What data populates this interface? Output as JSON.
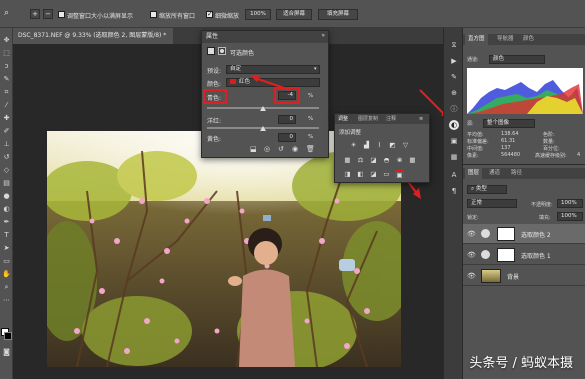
{
  "options_bar": {
    "resize_windows_label": "调整窗口大小以满屏显示",
    "zoom_all_label": "缩放所有窗口",
    "scrubby_zoom_label": "细微缩放",
    "zoom_100": "100%",
    "fit_screen": "适合屏幕",
    "fill_screen": "填充屏幕"
  },
  "document": {
    "tab_title": "DSC_8371.NEF @ 9.33% (选取颜色 2, 图层蒙版/8) *"
  },
  "properties": {
    "panel_title": "属性",
    "adjustment_name": "可选颜色",
    "preset_label": "预设:",
    "preset_value": "自定",
    "colors_label": "颜色:",
    "colors_value": "红色",
    "colors_swatch": "#d42020",
    "cyan_label": "青色:",
    "cyan_value": "-4",
    "magenta_label": "洋红:",
    "magenta_value": "0",
    "yellow_label": "黄色:",
    "yellow_value": "0",
    "percent": "%"
  },
  "adjustments": {
    "tab_adjust": "调整",
    "tab_styles": "图层复制",
    "tab_notes": "注释",
    "add_label": "添加调整"
  },
  "histogram": {
    "tab_histogram": "直方图",
    "tab_navigator": "导航器",
    "tab_color": "颜色",
    "channel_label": "通道:",
    "channel_value": "颜色",
    "source_label": "源:",
    "source_value": "整个图像",
    "mean_label": "平均值:",
    "mean_value": "138.64",
    "std_label": "标准偏差:",
    "std_value": "61.31",
    "median_label": "中间值:",
    "median_value": "137",
    "pixels_label": "像素:",
    "pixels_value": "564480",
    "level_label": "色阶:",
    "count_label": "数量:",
    "percentile_label": "百分位:",
    "cache_label": "高速缓存级别:",
    "cache_value": "4"
  },
  "layers_panel": {
    "tab_layers": "图层",
    "tab_channels": "通道",
    "tab_paths": "路径",
    "filter_label": "类型",
    "blend_mode": "正常",
    "opacity_label": "不透明度:",
    "opacity_value": "100%",
    "lock_label": "锁定:",
    "fill_label": "填充:",
    "fill_value": "100%",
    "layers": [
      {
        "name": "选取颜色 2"
      },
      {
        "name": "选取颜色 1"
      },
      {
        "name": "背景"
      }
    ]
  },
  "watermark": "头条号 / 蚂蚁本摄"
}
